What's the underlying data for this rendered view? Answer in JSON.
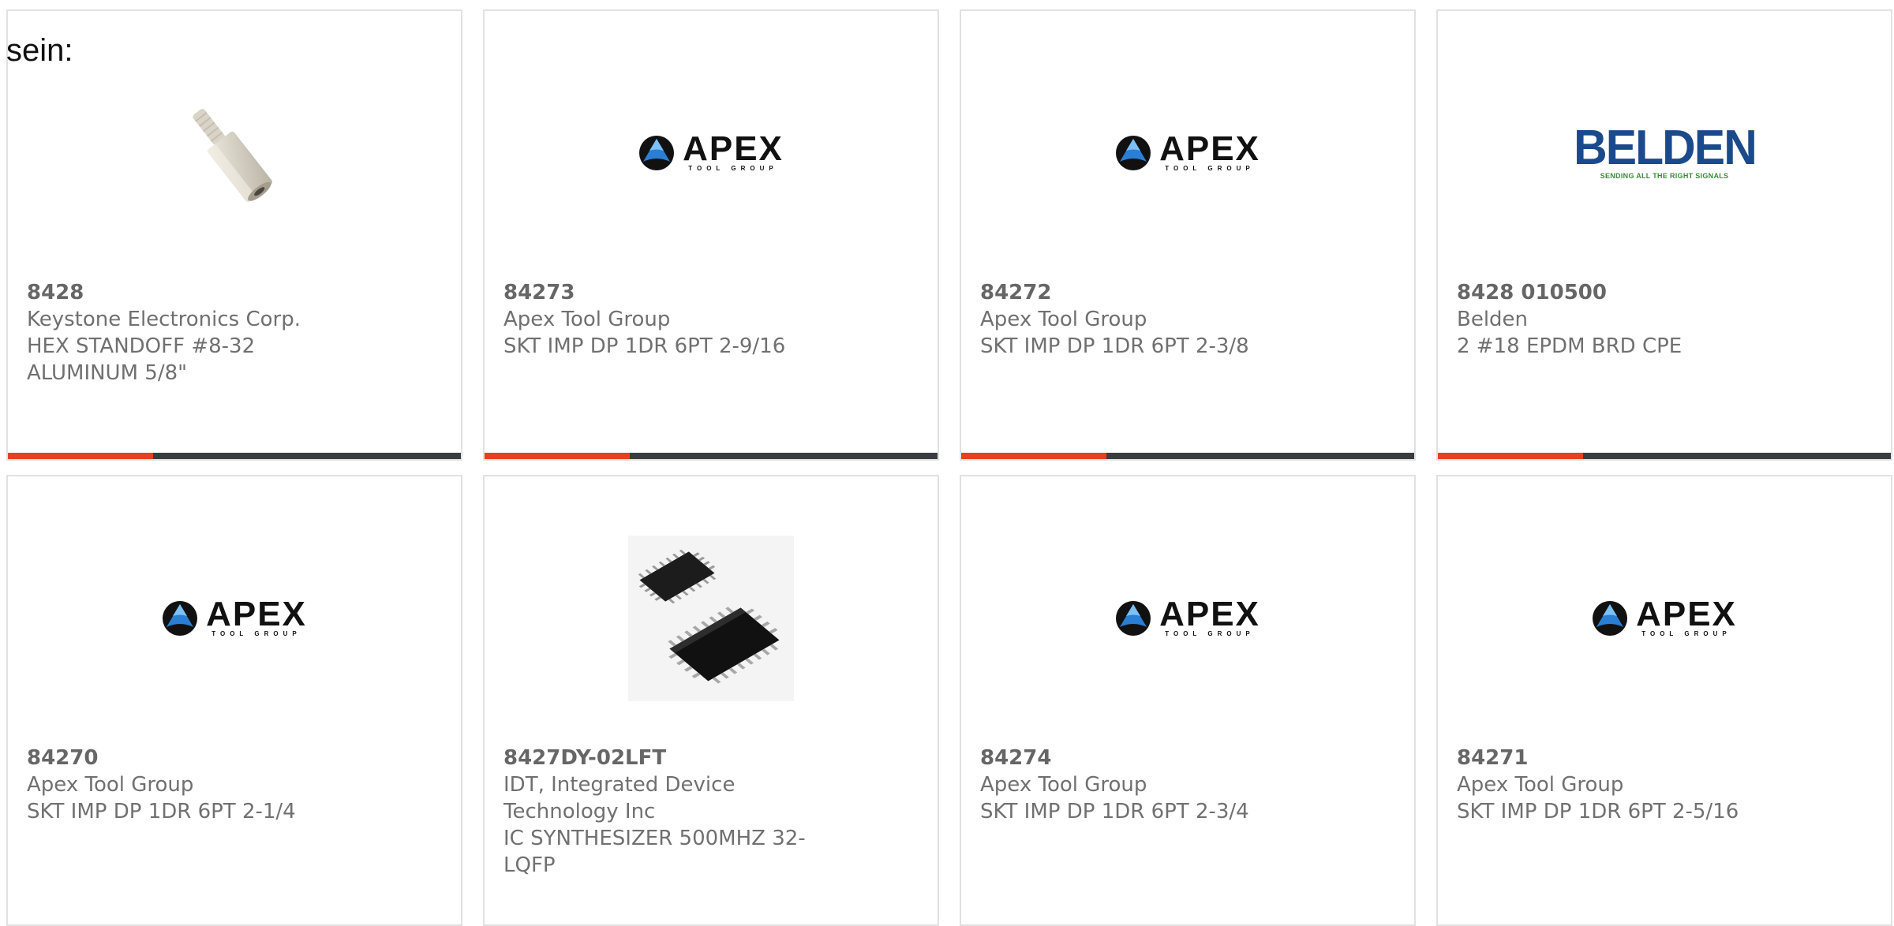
{
  "lead_text": "sein:",
  "accent_color": "#e8401c",
  "track_color": "#3a3d40",
  "cards": [
    {
      "part_number": "8428",
      "manufacturer": "Keystone Electronics Corp.",
      "description": "HEX STANDOFF #8-32 ALUMINUM 5/8\"",
      "image": "hex-standoff-photo",
      "progress": 0.32
    },
    {
      "part_number": "84273",
      "manufacturer": "Apex Tool Group",
      "description": "SKT IMP DP 1DR 6PT 2-9/16",
      "image": "apex-tool-group-logo",
      "logo_text": "APEX",
      "logo_subtext": "TOOL GROUP",
      "progress": 0.32
    },
    {
      "part_number": "84272",
      "manufacturer": "Apex Tool Group",
      "description": "SKT IMP DP 1DR 6PT 2-3/8",
      "image": "apex-tool-group-logo",
      "logo_text": "APEX",
      "logo_subtext": "TOOL GROUP",
      "progress": 0.32
    },
    {
      "part_number": "8428 010500",
      "manufacturer": "Belden",
      "description": "2 #18 EPDM BRD CPE",
      "image": "belden-logo",
      "logo_text": "BELDEN",
      "logo_subtext": "SENDING ALL THE RIGHT SIGNALS",
      "progress": 0.32
    },
    {
      "part_number": "84270",
      "manufacturer": "Apex Tool Group",
      "description": "SKT IMP DP 1DR 6PT 2-1/4",
      "image": "apex-tool-group-logo",
      "logo_text": "APEX",
      "logo_subtext": "TOOL GROUP"
    },
    {
      "part_number": "8427DY-02LFT",
      "manufacturer": "IDT, Integrated Device Technology Inc",
      "description": "IC SYNTHESIZER 500MHZ 32-LQFP",
      "image": "lqfp-chip-photo"
    },
    {
      "part_number": "84274",
      "manufacturer": "Apex Tool Group",
      "description": "SKT IMP DP 1DR 6PT 2-3/4",
      "image": "apex-tool-group-logo",
      "logo_text": "APEX",
      "logo_subtext": "TOOL GROUP"
    },
    {
      "part_number": "84271",
      "manufacturer": "Apex Tool Group",
      "description": "SKT IMP DP 1DR 6PT 2-5/16",
      "image": "apex-tool-group-logo",
      "logo_text": "APEX",
      "logo_subtext": "TOOL GROUP"
    }
  ]
}
